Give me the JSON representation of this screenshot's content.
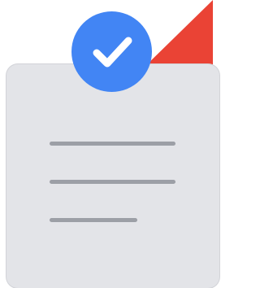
{
  "illustration": {
    "kind": "document-with-checkmark",
    "colors": {
      "background": "#ffffff",
      "card_fill": "#e3e4e8",
      "card_shadow": "#d2d3d8",
      "line_color": "#9c9fa6",
      "badge_fill": "#4285f4",
      "check_color": "#ffffff",
      "accent_triangle": "#ea4335"
    },
    "icons": {
      "badge": "check-icon",
      "card": "document-icon"
    },
    "text_line_count": 3
  }
}
